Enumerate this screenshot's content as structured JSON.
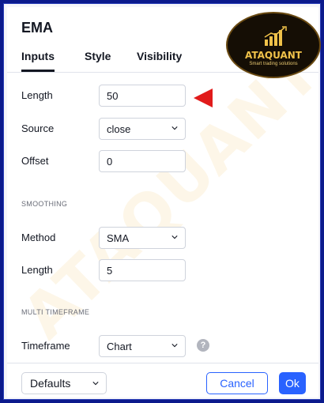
{
  "dialog": {
    "title": "EMA",
    "tabs": [
      {
        "label": "Inputs",
        "active": true
      },
      {
        "label": "Style",
        "active": false
      },
      {
        "label": "Visibility",
        "active": false
      }
    ]
  },
  "inputs": {
    "length": {
      "label": "Length",
      "value": "50"
    },
    "source": {
      "label": "Source",
      "value": "close"
    },
    "offset": {
      "label": "Offset",
      "value": "0"
    }
  },
  "smoothing": {
    "section_title": "SMOOTHING",
    "method": {
      "label": "Method",
      "value": "SMA"
    },
    "length": {
      "label": "Length",
      "value": "5"
    }
  },
  "multi_timeframe": {
    "section_title": "MULTI TIMEFRAME",
    "timeframe": {
      "label": "Timeframe",
      "value": "Chart"
    },
    "help_glyph": "?"
  },
  "footer": {
    "defaults_label": "Defaults",
    "cancel_label": "Cancel",
    "ok_label": "Ok"
  },
  "logo": {
    "name": "ATAQUANT",
    "tagline": "Smart trading solutions"
  },
  "watermark": "ATAQUANT",
  "colors": {
    "accent": "#2962ff",
    "annotation_arrow": "#e11b1b",
    "frame": "#0b1a8c",
    "logo_gold": "#f0c24a"
  },
  "icons": [
    "chevron-down-icon",
    "help-icon",
    "arrow-pointer-icon",
    "bar-chart-logo-icon"
  ]
}
